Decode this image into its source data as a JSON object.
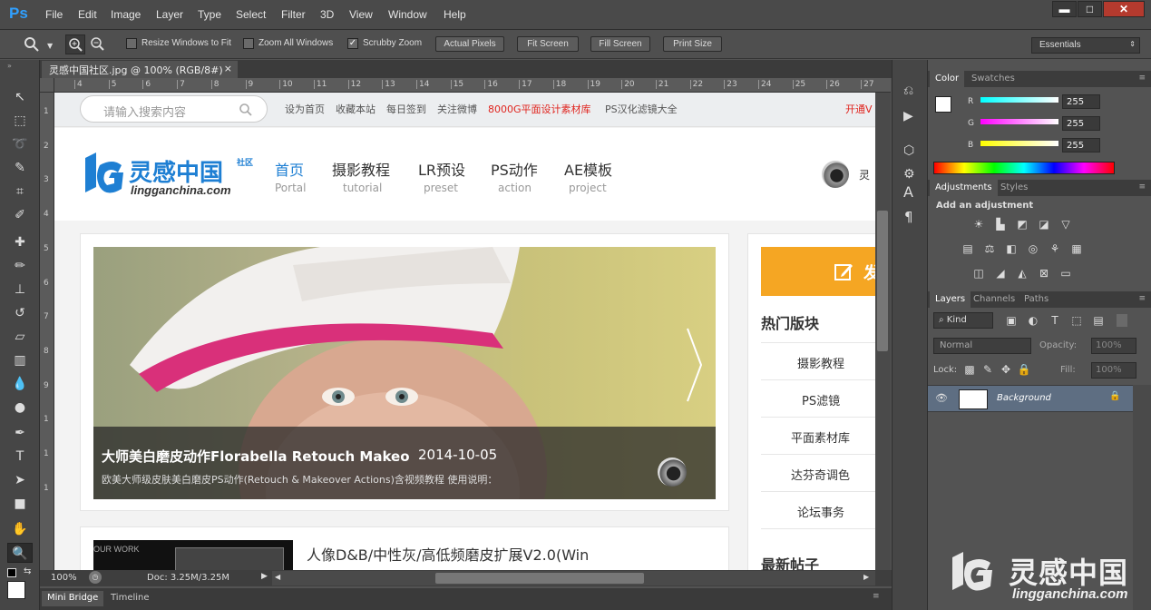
{
  "app": {
    "logo": "Ps",
    "menus": [
      "File",
      "Edit",
      "Image",
      "Layer",
      "Type",
      "Select",
      "Filter",
      "3D",
      "View",
      "Window",
      "Help"
    ],
    "window_buttons": [
      "▬",
      "□",
      "✕"
    ]
  },
  "options_bar": {
    "resize_windows": "Resize Windows to Fit",
    "zoom_all": "Zoom All Windows",
    "scrubby_zoom": "Scrubby Zoom",
    "actual_pixels": "Actual Pixels",
    "fit_screen": "Fit Screen",
    "fill_screen": "Fill Screen",
    "print_size": "Print Size",
    "workspace": "Essentials"
  },
  "document": {
    "tab_title": "灵感中国社区.jpg @ 100% (RGB/8#)",
    "close": "×",
    "ruler_h": [
      "4",
      "5",
      "6",
      "7",
      "8",
      "9",
      "10",
      "11",
      "12",
      "13",
      "14",
      "15",
      "16",
      "17",
      "18",
      "19",
      "20",
      "21",
      "22",
      "23",
      "24",
      "25",
      "26",
      "27"
    ],
    "ruler_v": [
      "1",
      "2",
      "3",
      "4",
      "5",
      "6",
      "7",
      "8",
      "9",
      "1",
      "1",
      "1"
    ]
  },
  "status": {
    "zoom": "100%",
    "doc": "Doc: 3.25M/3.25M"
  },
  "bottom_tabs": [
    "Mini Bridge",
    "Timeline"
  ],
  "panels": {
    "color_tabs": [
      "Color",
      "Swatches"
    ],
    "rgb": [
      {
        "label": "R",
        "value": "255"
      },
      {
        "label": "G",
        "value": "255"
      },
      {
        "label": "B",
        "value": "255"
      }
    ],
    "adjust_tabs": [
      "Adjustments",
      "Styles"
    ],
    "add_adjustment": "Add an adjustment",
    "layer_tabs": [
      "Layers",
      "Channels",
      "Paths"
    ],
    "kind": "Kind",
    "blend_mode": "Normal",
    "opacity_label": "Opacity:",
    "opacity_value": "100%",
    "lock_label": "Lock:",
    "fill_label": "Fill:",
    "fill_value": "100%",
    "layer_name": "Background"
  },
  "website": {
    "search_placeholder": "请输入搜索内容",
    "toplinks": [
      "设为首页",
      "收藏本站",
      "每日签到",
      "关注微博",
      "8000G平面设计素材库",
      "PS汉化滤镜大全"
    ],
    "topright": "开通V",
    "logo_cn": "灵感中国",
    "logo_badge": "社区",
    "logo_domain": "lingganchina.com",
    "nav": [
      {
        "cn": "首页",
        "en": "Portal"
      },
      {
        "cn": "摄影教程",
        "en": "tutorial"
      },
      {
        "cn": "LR预设",
        "en": "preset"
      },
      {
        "cn": "PS动作",
        "en": "action"
      },
      {
        "cn": "AE模板",
        "en": "project"
      }
    ],
    "user_initial": "灵",
    "slide_title": "大师美白磨皮动作Florabella Retouch Makeo",
    "slide_date": "2014-10-05",
    "slide_desc": "欧美大师级皮肤美白磨皮PS动作(Retouch & Makeover Actions)含视频教程 使用说明：",
    "post_btn": "发",
    "hot_title": "热门版块",
    "hot_items": [
      "摄影教程",
      "PS滤镜",
      "平面素材库",
      "达芬奇调色",
      "论坛事务"
    ],
    "latest_title": "最新帖子",
    "second_title": "人像D&B/中性灰/高低频磨皮扩展V2.0(Win",
    "thumb_text": "OUR WORK"
  },
  "watermark": {
    "cn": "灵感中国",
    "domain": "lingganchina.com"
  }
}
